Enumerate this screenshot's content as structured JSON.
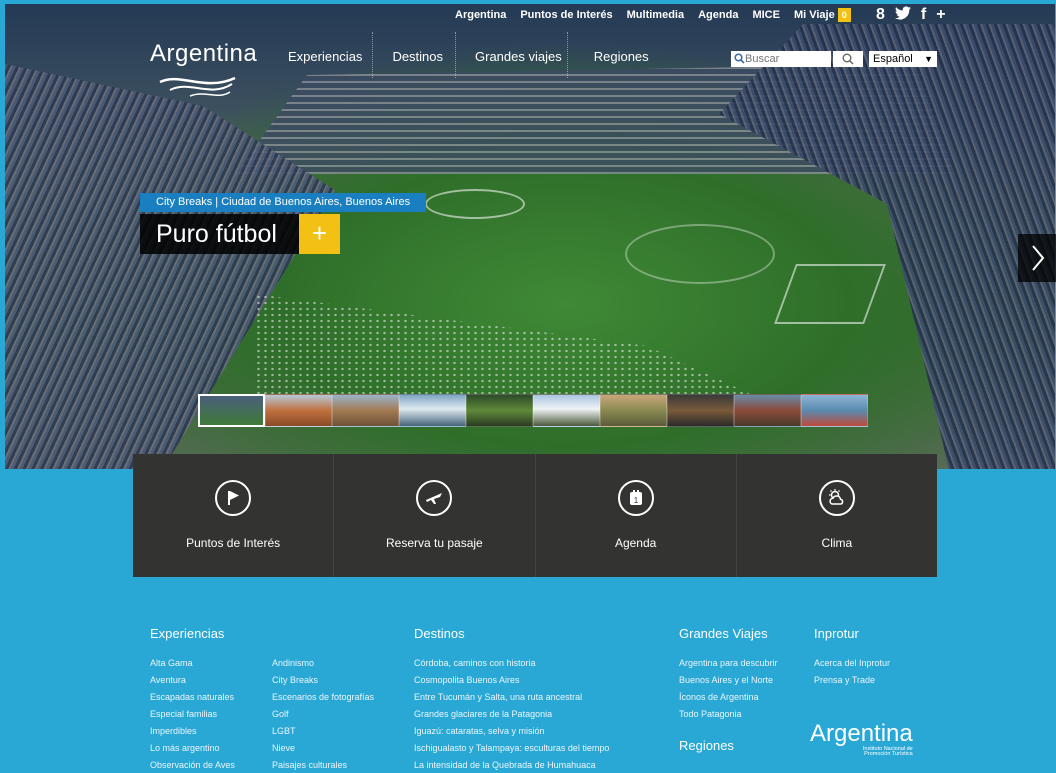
{
  "util_nav": [
    "Argentina",
    "Puntos de Interés",
    "Multimedia",
    "Agenda",
    "MICE",
    "Mi Viaje"
  ],
  "mi_viaje_count": "0",
  "social": [
    "8",
    "✔",
    "f",
    "+"
  ],
  "logo": {
    "word": "Argentina"
  },
  "main_nav": [
    "Experiencias",
    "Destinos",
    "Grandes viajes",
    "Regiones"
  ],
  "search": {
    "placeholder": "Buscar"
  },
  "language": {
    "selected": "Español"
  },
  "hero": {
    "tag": "City Breaks | Ciudad de Buenos Aires, Buenos Aires",
    "title": "Puro fútbol",
    "plus": "+"
  },
  "quick_links": [
    "Puntos de Interés",
    "Reserva tu pasaje",
    "Agenda",
    "Clima"
  ],
  "footer": {
    "experiencias": {
      "title": "Experiencias",
      "col1": [
        "Alta Gama",
        "Aventura",
        "Escapadas naturales",
        "Especial familias",
        "Imperdibles",
        "Lo más argentino",
        "Observación de Aves"
      ],
      "col2": [
        "Andinismo",
        "City Breaks",
        "Escenarios de fotografías",
        "Golf",
        "LGBT",
        "Nieve",
        "Paisajes culturales"
      ]
    },
    "destinos": {
      "title": "Destinos",
      "items": [
        "Córdoba, caminos con historia",
        "Cosmopolita Buenos Aires",
        "Entre Tucumán y Salta, una ruta ancestral",
        "Grandes glaciares de la Patagonia",
        "Iguazú: cataratas, selva y misión",
        "Ischigualasto y Talampaya: esculturas del tiempo",
        "La intensidad de la Quebrada de Humahuaca"
      ]
    },
    "grandes_viajes": {
      "title": "Grandes Viajes",
      "items": [
        "Argentina para descubrir",
        "Buenos Aires y el Norte",
        "Íconos de Argentina",
        "Todo Patagonia"
      ]
    },
    "regiones": {
      "title": "Regiones"
    },
    "inprotur": {
      "title": "Inprotur",
      "items": [
        "Acerca del Inprotur",
        "Prensa y Trade"
      ]
    },
    "logo": {
      "word": "Argentina",
      "line1": "Instituto Nacional de",
      "line2": "Promoción Turística"
    }
  },
  "colors": {
    "page_bg": "#29a8d6",
    "accent_yellow": "#f2c114",
    "tag_blue": "#1a7fc0",
    "tile_dark": "#333332"
  }
}
